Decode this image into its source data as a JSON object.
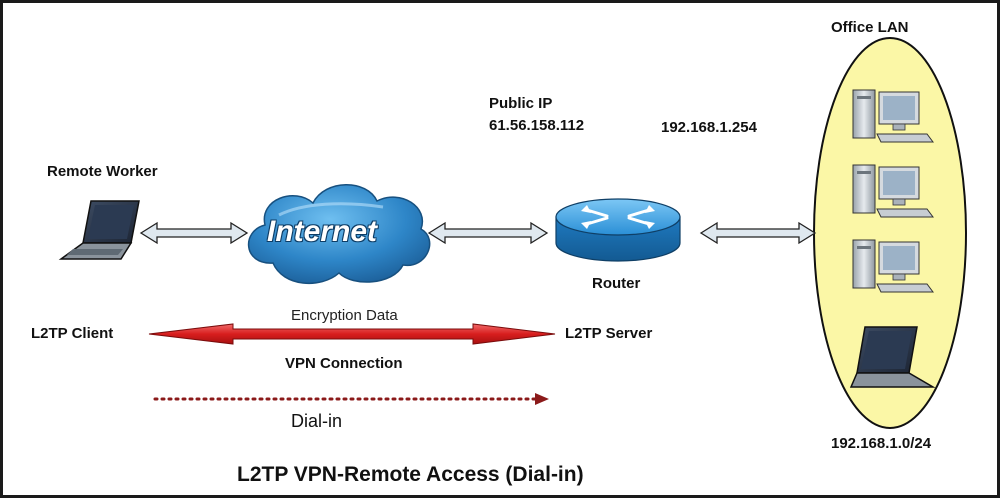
{
  "title": "L2TP VPN-Remote Access (Dial-in)",
  "office_lan": {
    "label": "Office LAN",
    "subnet": "192.168.1.0/24"
  },
  "remote_worker": {
    "label": "Remote Worker",
    "role": "L2TP Client"
  },
  "internet": {
    "label": "Internet"
  },
  "router": {
    "label": "Router",
    "public_ip_label": "Public IP",
    "public_ip": "61.56.158.112",
    "lan_ip": "192.168.1.254",
    "role": "L2TP Server"
  },
  "tunnel": {
    "top_label": "Encryption Data",
    "bottom_label": "VPN Connection",
    "color": "#d81e1e"
  },
  "dialin": {
    "label": "Dial-in",
    "color": "#8b1a1a"
  },
  "colors": {
    "lan_ellipse_fill": "#fbf7a6",
    "internet_cloud": "#2e86c8",
    "router_body": "#2a8fd6",
    "double_arrow_fill": "#dfe8ef"
  }
}
